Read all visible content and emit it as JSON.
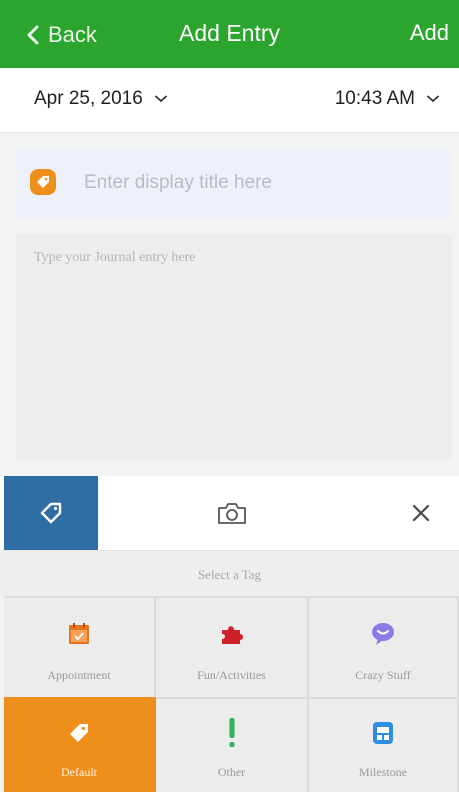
{
  "navbar": {
    "back_label": "Back",
    "title": "Add Entry",
    "add_label": "Add",
    "color": "#2ba52e"
  },
  "datetime": {
    "date": "Apr 25, 2016",
    "time": "10:43 AM"
  },
  "entry": {
    "title_placeholder": "Enter display title here",
    "title_value": "",
    "body_placeholder": "Type your Journal entry here",
    "body_value": ""
  },
  "toolbar": {
    "active_tool": "tag",
    "icons": [
      "tag-icon",
      "camera-icon",
      "close-icon"
    ],
    "active_color": "#2f6ea4"
  },
  "tags": {
    "caption": "Select a Tag",
    "selected": "Default",
    "selected_color": "#ee8f1b",
    "items": [
      {
        "label": "Appointment",
        "icon": "calendar-icon",
        "color": "#e8731e"
      },
      {
        "label": "Fun/Activities",
        "icon": "puzzle-icon",
        "color": "#d0202a"
      },
      {
        "label": "Crazy Stuff",
        "icon": "speech-bubble-icon",
        "color": "#8b7be6"
      },
      {
        "label": "Default",
        "icon": "tag-icon",
        "color": "#ffffff"
      },
      {
        "label": "Other",
        "icon": "exclamation-icon",
        "color": "#2fb25a"
      },
      {
        "label": "Milestone",
        "icon": "milestone-calendar-icon",
        "color": "#2e8fe0"
      }
    ]
  }
}
